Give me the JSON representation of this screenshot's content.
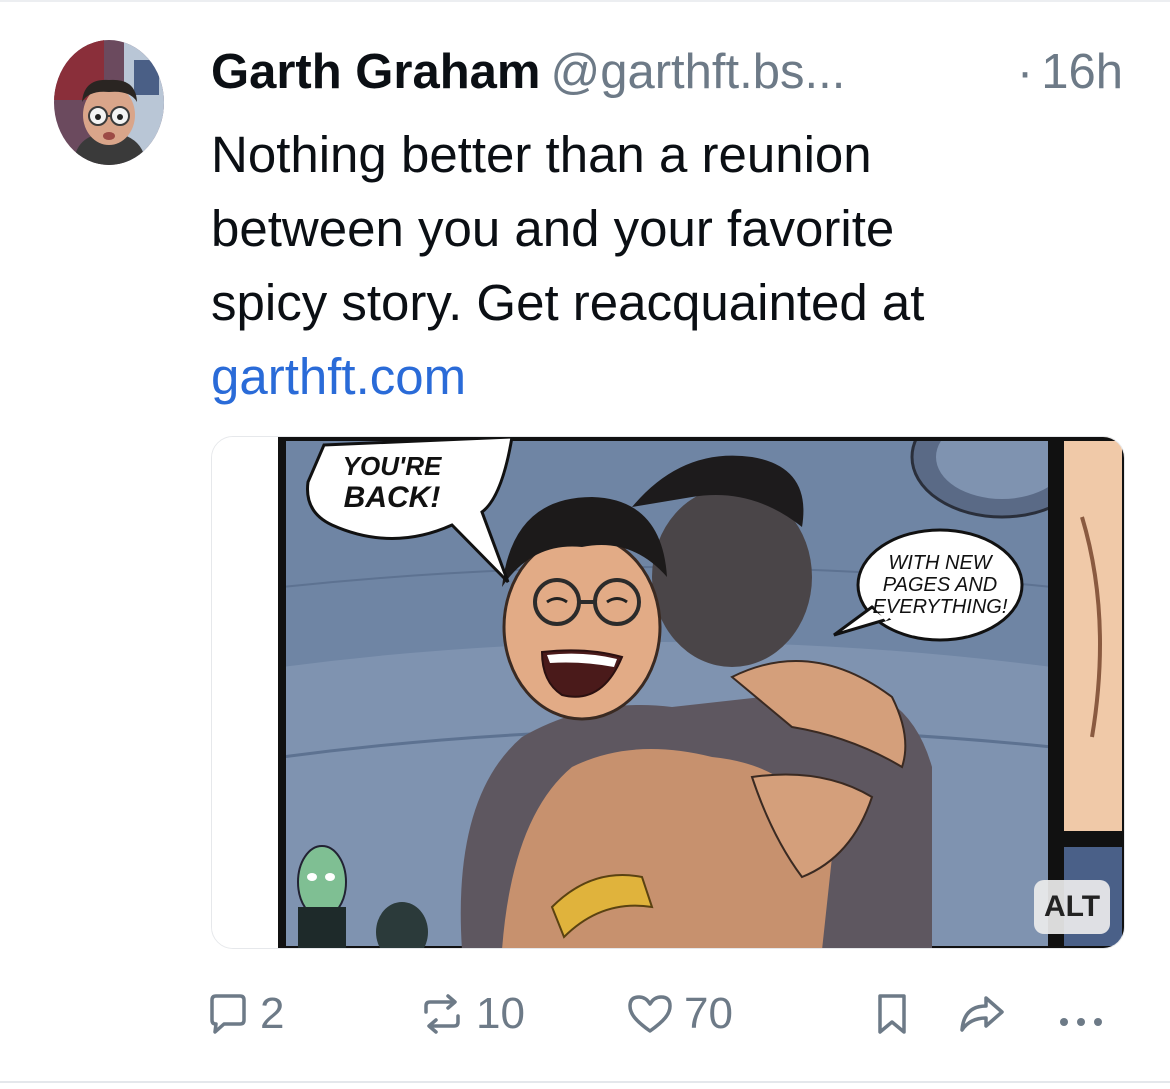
{
  "post": {
    "author": {
      "display_name": "Garth Graham",
      "handle": "@garthft.bs...",
      "avatar_icon": "user-avatar"
    },
    "separator": "·",
    "time": "16h",
    "text_lines": [
      "Nothing better than a reunion",
      "between you and your favorite",
      "spicy story. Get reacquainted at"
    ],
    "link_text": "garthft.com",
    "image": {
      "speech_bubble_1": [
        "YOU'RE",
        "BACK!"
      ],
      "speech_bubble_2": [
        "WITH NEW",
        "PAGES AND",
        "EVERYTHING!"
      ],
      "alt_badge": "ALT"
    },
    "actions": {
      "reply_count": "2",
      "repost_count": "10",
      "like_count": "70",
      "reply_icon": "reply-icon",
      "repost_icon": "repost-icon",
      "like_icon": "heart-icon",
      "bookmark_icon": "bookmark-icon",
      "share_icon": "share-icon",
      "more_icon": "more-icon"
    },
    "colors": {
      "link": "#2a6bd8",
      "muted": "#6d7a87",
      "text": "#0b0f14"
    }
  }
}
